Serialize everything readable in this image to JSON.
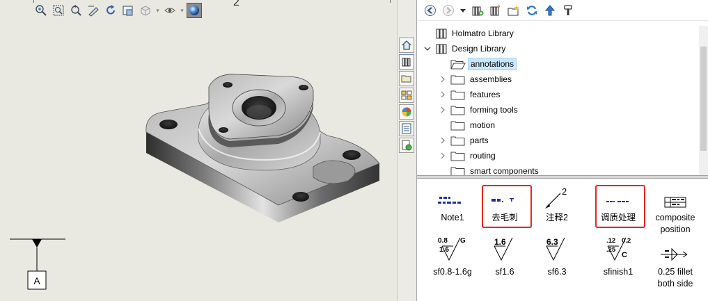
{
  "viewport": {
    "toolbar_icons": [
      "zoom-to-fit-icon",
      "zoom-to-area-icon",
      "previous-view-icon",
      "section-view-icon",
      "rotate-view-icon",
      "view-orientation-icon",
      "display-style-icon",
      "hide-show-items-icon",
      "edit-appearance-icon",
      "apply-scene-icon"
    ],
    "label_2": "2",
    "datum_label": "A"
  },
  "tabs": [
    "home-icon",
    "design-library-icon",
    "file-explorer-icon",
    "view-palette-icon",
    "appearances-icon",
    "custom-properties-icon",
    "document-recovery-icon"
  ],
  "library_toolbar": [
    "back-arrow-icon",
    "forward-arrow-icon",
    "dropdown-arrow-icon",
    "add-to-library-icon",
    "add-file-location-icon",
    "create-new-folder-icon",
    "refresh-icon",
    "up-one-level-icon",
    "options-icon"
  ],
  "tree": {
    "items": [
      {
        "label": "Holmatro Library",
        "level": 0,
        "expander": "none",
        "icon": "library-icon"
      },
      {
        "label": "Design Library",
        "level": 0,
        "expander": "expanded",
        "icon": "library-icon"
      },
      {
        "label": "annotations",
        "level": 1,
        "expander": "none",
        "icon": "folder-open-icon",
        "selected": true
      },
      {
        "label": "assemblies",
        "level": 1,
        "expander": "collapsed",
        "icon": "folder-icon"
      },
      {
        "label": "features",
        "level": 1,
        "expander": "collapsed",
        "icon": "folder-icon"
      },
      {
        "label": "forming tools",
        "level": 1,
        "expander": "collapsed",
        "icon": "folder-icon"
      },
      {
        "label": "motion",
        "level": 1,
        "expander": "none",
        "icon": "folder-icon"
      },
      {
        "label": "parts",
        "level": 1,
        "expander": "collapsed",
        "icon": "folder-icon"
      },
      {
        "label": "routing",
        "level": 1,
        "expander": "collapsed",
        "icon": "folder-icon"
      },
      {
        "label": "smart components",
        "level": 1,
        "expander": "none",
        "icon": "folder-icon"
      }
    ]
  },
  "palette": {
    "items": [
      {
        "label": "Note1",
        "preview": "note-preview"
      },
      {
        "label": "去毛刺",
        "preview": "deburr-note-preview",
        "highlighted": true
      },
      {
        "label": "注释2",
        "preview": "balloon-note-preview"
      },
      {
        "label": "调质处理",
        "preview": "heat-treatment-note-preview",
        "highlighted": true
      },
      {
        "label": "composite\nposition",
        "preview": "composite-position-preview"
      },
      {
        "label": "sf0.8-1.6g",
        "preview": "surface-finish-preview",
        "sf_texts": [
          "0.8",
          "G",
          "1.6"
        ]
      },
      {
        "label": "sf1.6",
        "preview": "surface-finish-preview",
        "sf_texts": [
          "1.6"
        ]
      },
      {
        "label": "sf6.3",
        "preview": "surface-finish-preview",
        "sf_texts": [
          "6.3"
        ]
      },
      {
        "label": "sfinish1",
        "preview": "surface-finish-preview",
        "sf_texts": [
          ".12",
          "0.2",
          ".25",
          "C"
        ]
      },
      {
        "label": "0.25 fillet\nboth side",
        "preview": "weld-symbol-preview"
      }
    ]
  }
}
